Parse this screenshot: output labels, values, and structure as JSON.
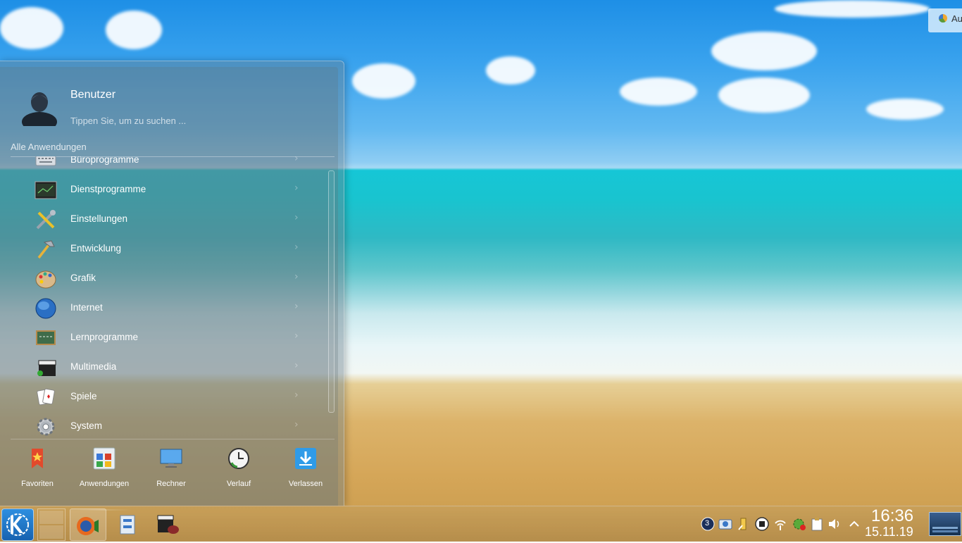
{
  "user": {
    "name": "Benutzer"
  },
  "search": {
    "placeholder": "Tippen Sie, um zu suchen ..."
  },
  "section_label": "Alle Anwendungen",
  "categories": [
    {
      "label": "Büroprogramme",
      "icon": "keyboard-icon"
    },
    {
      "label": "Dienstprogramme",
      "icon": "terminal-icon"
    },
    {
      "label": "Einstellungen",
      "icon": "tools-icon"
    },
    {
      "label": "Entwicklung",
      "icon": "hammer-icon"
    },
    {
      "label": "Grafik",
      "icon": "palette-icon"
    },
    {
      "label": "Internet",
      "icon": "globe-icon"
    },
    {
      "label": "Lernprogramme",
      "icon": "chalkboard-icon"
    },
    {
      "label": "Multimedia",
      "icon": "clapperboard-icon"
    },
    {
      "label": "Spiele",
      "icon": "playing-cards-icon"
    },
    {
      "label": "System",
      "icon": "gear-icon"
    }
  ],
  "tabs": [
    {
      "label": "Favoriten",
      "icon": "bookmark-star-icon"
    },
    {
      "label": "Anwendungen",
      "icon": "applications-grid-icon"
    },
    {
      "label": "Rechner",
      "icon": "computer-icon"
    },
    {
      "label": "Verlauf",
      "icon": "history-clock-icon"
    },
    {
      "label": "Verlassen",
      "icon": "leave-arrow-icon"
    }
  ],
  "active_tab": "Anwendungen",
  "notification": {
    "text": "Au"
  },
  "tray": {
    "badge_count": "3"
  },
  "clock": {
    "time": "16:36",
    "date": "15.11.19"
  },
  "colors": {
    "kde_blue": "#1d74c8",
    "taskbar": "#c29a55"
  }
}
